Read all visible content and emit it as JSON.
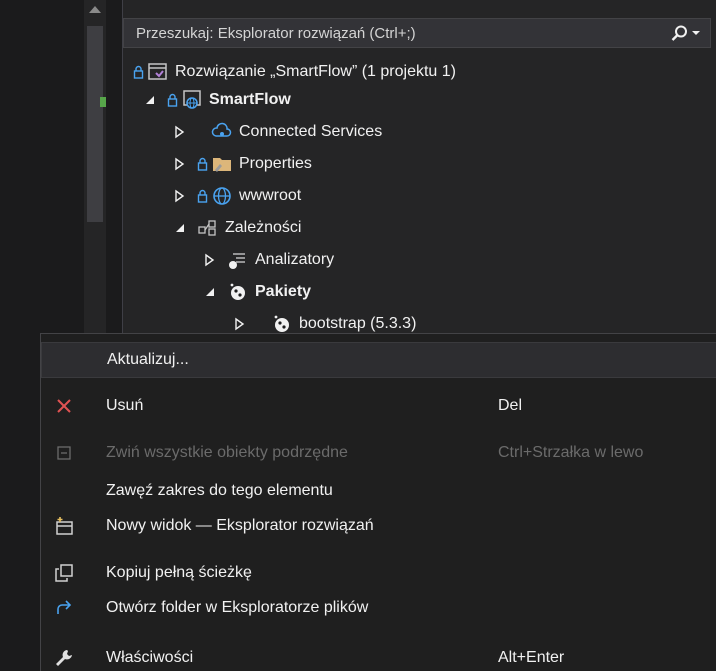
{
  "search": {
    "placeholder": "Przeszukaj: Eksplorator rozwiązań (Ctrl+;)"
  },
  "tree": {
    "solution": "Rozwiązanie „SmartFlow” (1 projektu 1)",
    "project": "SmartFlow",
    "connected_services": "Connected Services",
    "properties": "Properties",
    "wwwroot": "wwwroot",
    "dependencies": "Zależności",
    "analyzers": "Analizatory",
    "packages": "Pakiety",
    "bootstrap": "bootstrap (5.3.3)"
  },
  "menu": {
    "update": "Aktualizuj...",
    "delete": "Usuń",
    "delete_key": "Del",
    "collapse_all": "Zwiń wszystkie obiekty podrzędne",
    "collapse_all_key": "Ctrl+Strzałka w lewo",
    "scope_to_this": "Zawęź zakres do tego elementu",
    "new_view": "Nowy widok — Eksplorator rozwiązań",
    "copy_full_path": "Kopiuj pełną ścieżkę",
    "open_folder": "Otwórz folder w Eksploratorze plików",
    "properties": "Właściwości",
    "properties_key": "Alt+Enter"
  },
  "colors": {
    "accent_blue": "#4aa3f0",
    "delete_red": "#e05252",
    "modified_green": "#57a64a"
  }
}
